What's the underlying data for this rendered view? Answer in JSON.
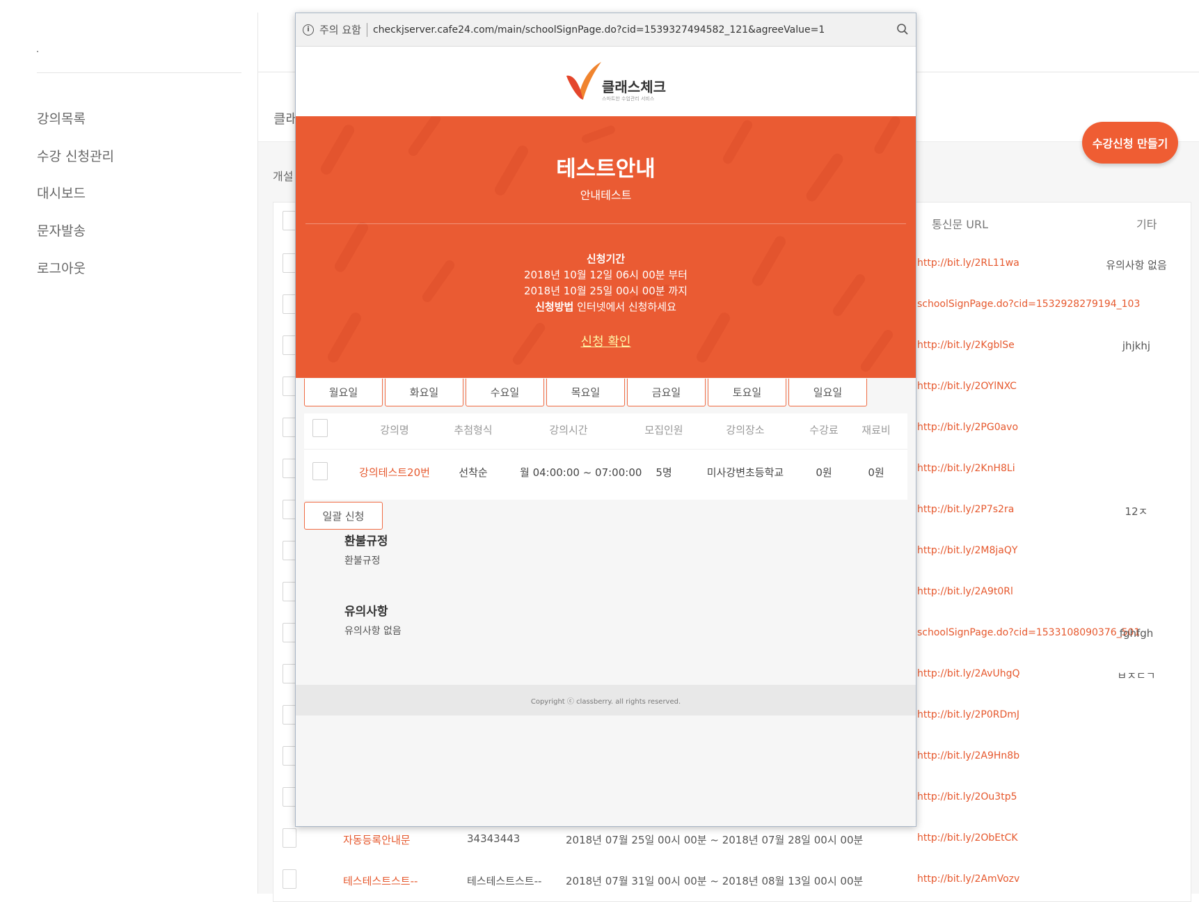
{
  "sidebar": {
    "items": [
      {
        "label": "강의목록"
      },
      {
        "label": "수강 신청관리"
      },
      {
        "label": "대시보드"
      },
      {
        "label": "문자발송"
      },
      {
        "label": "로그아웃"
      }
    ]
  },
  "main": {
    "band_title_partial": "클래",
    "open_label_partial": "개설",
    "create_button": "수강신청 만들기",
    "headers": {
      "url": "통신문 URL",
      "extra": "기타"
    },
    "rows": [
      {
        "url": "http://bit.ly/2RL11wa",
        "extra": "유의사항 없음"
      },
      {
        "url": "schoolSignPage.do?cid=1532928279194_103",
        "extra": ""
      },
      {
        "url": "http://bit.ly/2KgblSe",
        "extra": "jhjkhj"
      },
      {
        "url": "http://bit.ly/2OYlNXC",
        "extra": ""
      },
      {
        "url": "http://bit.ly/2PG0avo",
        "extra": ""
      },
      {
        "url": "http://bit.ly/2KnH8Li",
        "extra": ""
      },
      {
        "url": "http://bit.ly/2P7s2ra",
        "extra": "12ㅈ"
      },
      {
        "url": "http://bit.ly/2M8jaQY",
        "extra": ""
      },
      {
        "url": "http://bit.ly/2A9t0Rl",
        "extra": ""
      },
      {
        "url": "schoolSignPage.do?cid=1533108090376_501",
        "extra": "fghfgh"
      },
      {
        "url": "http://bit.ly/2AvUhgQ",
        "extra": "ㅂㅈㄷㄱ"
      },
      {
        "url": "http://bit.ly/2P0RDmJ",
        "extra": ""
      },
      {
        "url": "http://bit.ly/2A9Hn8b",
        "extra": ""
      },
      {
        "url": "http://bit.ly/2Ou3tp5",
        "extra": ""
      },
      {
        "url": "http://bit.ly/2ObEtCK",
        "extra": ""
      },
      {
        "url": "http://bit.ly/2AmVozv",
        "extra": ""
      }
    ],
    "bottom_rows": [
      {
        "name": "자동등록안내문",
        "code": "34343443",
        "period": "2018년 07월 25일 00시 00분 ~ 2018년 07월 28일 00시 00분"
      },
      {
        "name": "테스테스트스트--",
        "code": "테스테스트스트--",
        "period": "2018년 07월 31일 00시 00분 ~ 2018년 08월 13일 00시 00분"
      }
    ]
  },
  "popup": {
    "address": {
      "warning": "주의 요함",
      "url": "checkjserver.cafe24.com/main/schoolSignPage.do?cid=1539327494582_121&agreeValue=1"
    },
    "logo": {
      "name": "클래스체크",
      "tagline": "스마트한 수업관리 서비스"
    },
    "hero": {
      "title": "테스트안내",
      "subtitle": "안내테스트",
      "period_label": "신청기간",
      "period_start": "2018년 10월 12일 06시 00분 부터",
      "period_end": "2018년 10월 25일 00시 00분 까지",
      "method_label": "신청방법",
      "method_text": "인터넷에서 신청하세요",
      "confirm_link": "신청 확인"
    },
    "days": [
      "월요일",
      "화요일",
      "수요일",
      "목요일",
      "금요일",
      "토요일",
      "일요일"
    ],
    "table": {
      "headers": [
        "강의명",
        "추첨형식",
        "강의시간",
        "모집인원",
        "강의장소",
        "수강료",
        "재료비"
      ],
      "row": {
        "name": "강의테스트20번",
        "type": "선착순",
        "time": "월 04:00:00 ~ 07:00:00",
        "capacity": "5명",
        "place": "미사강변초등학교",
        "fee": "0원",
        "material": "0원"
      }
    },
    "bulk_button": "일괄 신청",
    "refund": {
      "title": "환불규정",
      "body": "환불규정"
    },
    "notes": {
      "title": "유의사항",
      "body": "유의사항 없음"
    },
    "footer": "Copyright ⓒ classberry. all rights reserved.",
    "colors": {
      "brand": "#ea5b33",
      "link": "#e6582d"
    }
  }
}
